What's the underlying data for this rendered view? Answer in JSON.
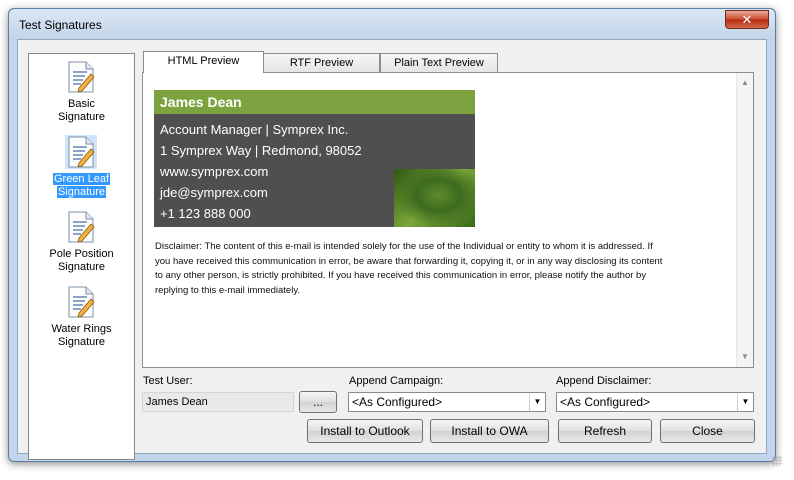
{
  "window": {
    "title": "Test Signatures",
    "close_label": "✕"
  },
  "sidebar": {
    "items": [
      {
        "label_line1": "Basic",
        "label_line2": "Signature",
        "selected": false,
        "icon": "document-pen-icon"
      },
      {
        "label_line1": "Green Leaf",
        "label_line2": "Signature",
        "selected": true,
        "icon": "document-pen-icon"
      },
      {
        "label_line1": "Pole Position",
        "label_line2": "Signature",
        "selected": false,
        "icon": "document-pen-icon"
      },
      {
        "label_line1": "Water Rings",
        "label_line2": "Signature",
        "selected": false,
        "icon": "document-pen-icon"
      }
    ]
  },
  "tabs": [
    {
      "label": "HTML Preview",
      "active": true
    },
    {
      "label": "RTF Preview",
      "active": false
    },
    {
      "label": "Plain Text Preview",
      "active": false
    }
  ],
  "preview": {
    "name": "James Dean",
    "line1": "Account Manager | Symprex Inc.",
    "line2": "1 Symprex Way | Redmond, 98052",
    "line3": "www.symprex.com",
    "line4": "jde@symprex.com",
    "line5": "+1 123 888 000",
    "disclaimer_line1": "Disclaimer: The content of this e-mail is intended solely for the use of the Individual or entity to whom it is addressed. If",
    "disclaimer_line2": "you have received this communication in error, be aware that forwarding it, copying it, or in any way disclosing its content",
    "disclaimer_line3": "to any other person, is strictly prohibited. If you have received this communication in error, please notify the author by",
    "disclaimer_line4": "replying to this e-mail immediately.",
    "scroll_up": "▲",
    "scroll_down": "▼"
  },
  "form": {
    "test_user_label": "Test User:",
    "test_user_value": "James Dean",
    "browse_label": "...",
    "append_campaign_label": "Append Campaign:",
    "append_campaign_value": "<As Configured>",
    "append_disclaimer_label": "Append Disclaimer:",
    "append_disclaimer_value": "<As Configured>",
    "dropdown_arrow": "▼"
  },
  "buttons": {
    "install_outlook": "Install to Outlook",
    "install_owa": "Install to OWA",
    "refresh": "Refresh",
    "close": "Close"
  },
  "colors": {
    "accent_green": "#7ba23f",
    "card_background": "#4f4f4f",
    "selection": "#3399ff"
  }
}
